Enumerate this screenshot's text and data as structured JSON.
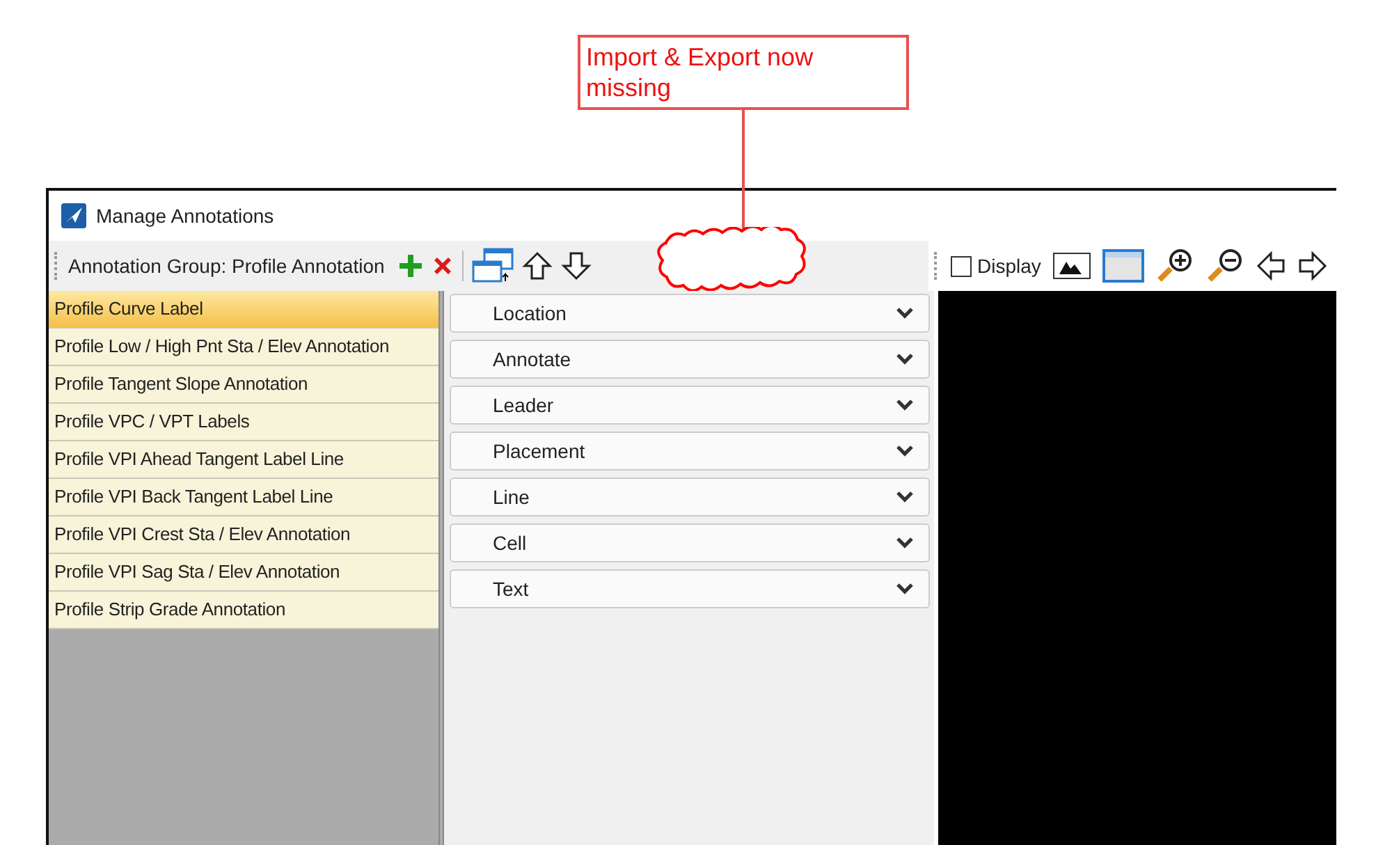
{
  "callout": {
    "text": "Import & Export now missing"
  },
  "window": {
    "title": "Manage Annotations"
  },
  "toolbar": {
    "group_label": "Annotation Group: Profile Annotation"
  },
  "preview_toolbar": {
    "display": {
      "label": "Display",
      "checked": false
    }
  },
  "annotations": [
    {
      "label": "Profile Curve Label",
      "selected": true
    },
    {
      "label": "Profile Low / High Pnt Sta / Elev Annotation",
      "selected": false
    },
    {
      "label": "Profile Tangent Slope Annotation",
      "selected": false
    },
    {
      "label": "Profile VPC / VPT Labels",
      "selected": false
    },
    {
      "label": "Profile VPI Ahead Tangent Label Line",
      "selected": false
    },
    {
      "label": "Profile VPI Back Tangent Label Line",
      "selected": false
    },
    {
      "label": "Profile VPI Crest Sta / Elev Annotation",
      "selected": false
    },
    {
      "label": "Profile VPI Sag Sta / Elev Annotation",
      "selected": false
    },
    {
      "label": "Profile Strip Grade Annotation",
      "selected": false
    }
  ],
  "sections": [
    {
      "label": "Location",
      "expanded": false
    },
    {
      "label": "Annotate",
      "expanded": false
    },
    {
      "label": "Leader",
      "expanded": false
    },
    {
      "label": "Placement",
      "expanded": false
    },
    {
      "label": "Line",
      "expanded": false
    },
    {
      "label": "Cell",
      "expanded": false
    },
    {
      "label": "Text",
      "expanded": false
    }
  ]
}
